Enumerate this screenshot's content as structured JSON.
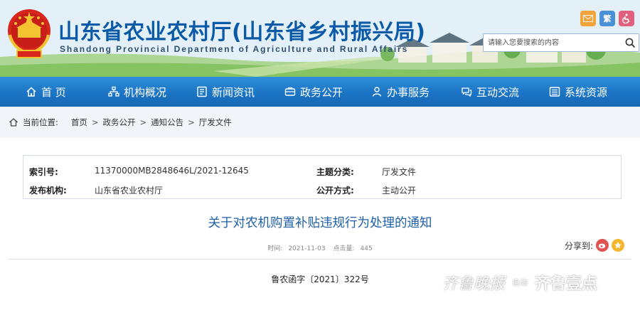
{
  "site": {
    "title_cn": "山东省农业农村厅(山东省乡村振兴局)",
    "title_en": "Shandong Provincial Department of Agriculture and Rural Affairs",
    "lang_label": "繁",
    "search_placeholder": "请输入您要搜索的内容"
  },
  "nav": {
    "items": [
      {
        "label": "首 页",
        "icon": "home-icon"
      },
      {
        "label": "机构概况",
        "icon": "org-icon"
      },
      {
        "label": "新闻资讯",
        "icon": "news-icon"
      },
      {
        "label": "政务公开",
        "icon": "open-icon"
      },
      {
        "label": "办事服务",
        "icon": "service-icon"
      },
      {
        "label": "互动交流",
        "icon": "interact-icon"
      },
      {
        "label": "系统资源",
        "icon": "system-icon"
      }
    ]
  },
  "breadcrumb": {
    "label": "当前位置:",
    "items": [
      "首页",
      "政务公开",
      "通知公告",
      "厅发文件"
    ],
    "sep": ">"
  },
  "meta": {
    "index_key": "索引号:",
    "index_val": "11370000MB2848646L/2021-12645",
    "topic_key": "主题分类:",
    "topic_val": "厅发文件",
    "publisher_key": "发布机构:",
    "publisher_val": "山东省农业农村厅",
    "mode_key": "公开方式:",
    "mode_val": "主动公开"
  },
  "article": {
    "title": "关于对农机购置补贴违规行为处理的通知",
    "time_label": "时间:",
    "time_val": "2021-11-03",
    "views_label": "点击量:",
    "views_val": "445",
    "share_label": "分享到:",
    "doc_no": "鲁农函字〔2021〕322号"
  },
  "watermark": {
    "text_a": "齐鲁晚报",
    "box": "自动",
    "text_b": "齐鲁壹点"
  },
  "colors": {
    "nav_blue": "#1b74c4",
    "title_blue": "#0b5aa8",
    "article_title": "#1f5fa8"
  }
}
